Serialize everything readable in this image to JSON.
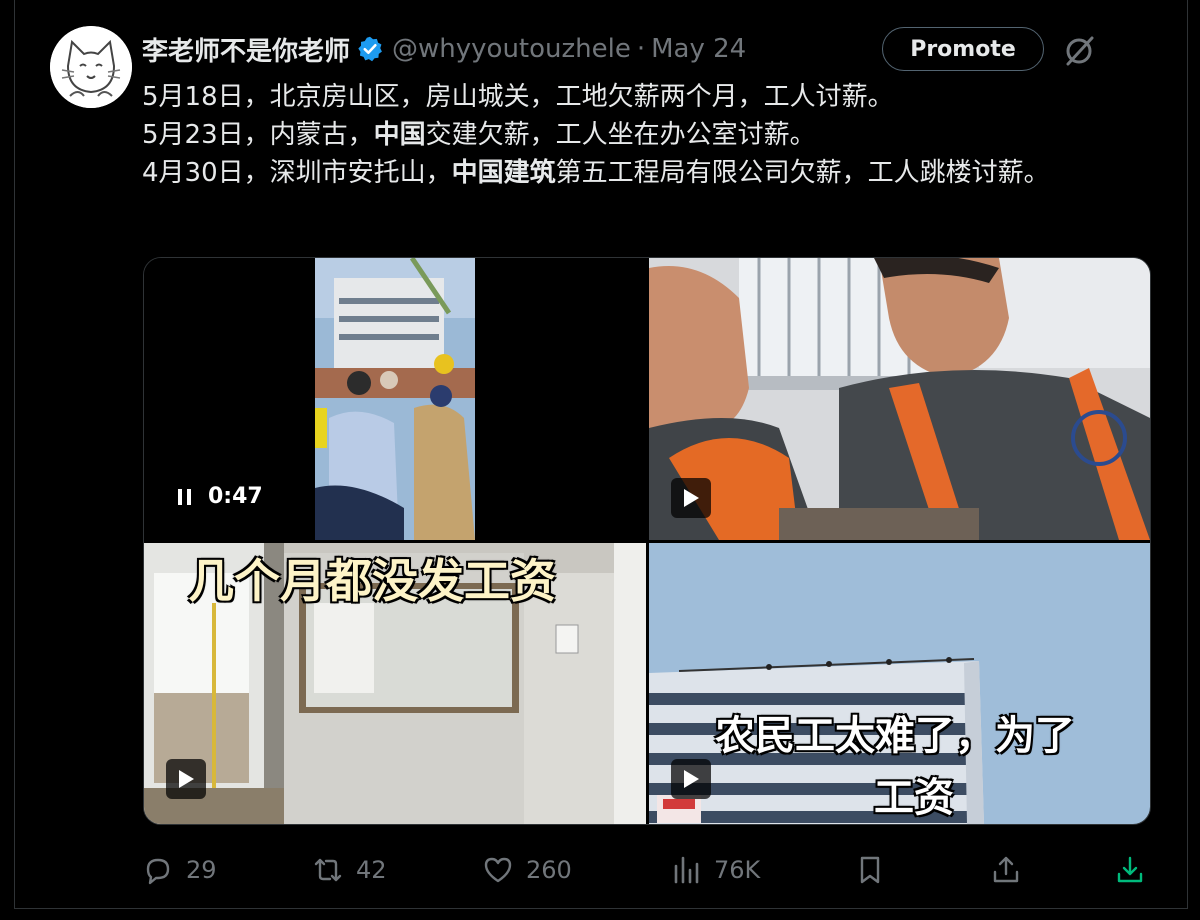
{
  "tweet": {
    "display_name": "李老师不是你老师",
    "handle": "@whyyoutouzhele",
    "separator": "·",
    "date": "May 24",
    "promote_label": "Promote",
    "lines": [
      {
        "a": "5月18日，北京房山区，房山城关，工地欠薪两个月，工人讨薪。",
        "b": "",
        "c": "",
        "d": "",
        "e": ""
      },
      {
        "a": "5月23日，内蒙古，",
        "b": "中国",
        "c": "交建欠薪，工人坐在办公室讨薪。",
        "d": "",
        "e": ""
      },
      {
        "a": "4月30日，深圳市安托山，",
        "b": "中国建筑",
        "c": "第五工程局有限公司欠薪，工人跳楼讨薪。",
        "d": "",
        "e": ""
      }
    ]
  },
  "media": {
    "video_time": "0:47",
    "caption_3": "几个月都没发工资",
    "caption_4a": "农民工太难了，为了",
    "caption_4b": "工资"
  },
  "actions": {
    "replies": "29",
    "reposts": "42",
    "likes": "260",
    "views": "76K"
  },
  "colors": {
    "background": "#000000",
    "text": "#e7e9ea",
    "muted": "#71767b",
    "verified": "#1d9bf0",
    "download": "#00ba7c"
  },
  "icons": [
    "verified-badge-icon",
    "grok-icon",
    "pause-icon",
    "play-icon",
    "reply-icon",
    "repost-icon",
    "like-icon",
    "views-icon",
    "bookmark-icon",
    "share-icon",
    "download-icon"
  ]
}
